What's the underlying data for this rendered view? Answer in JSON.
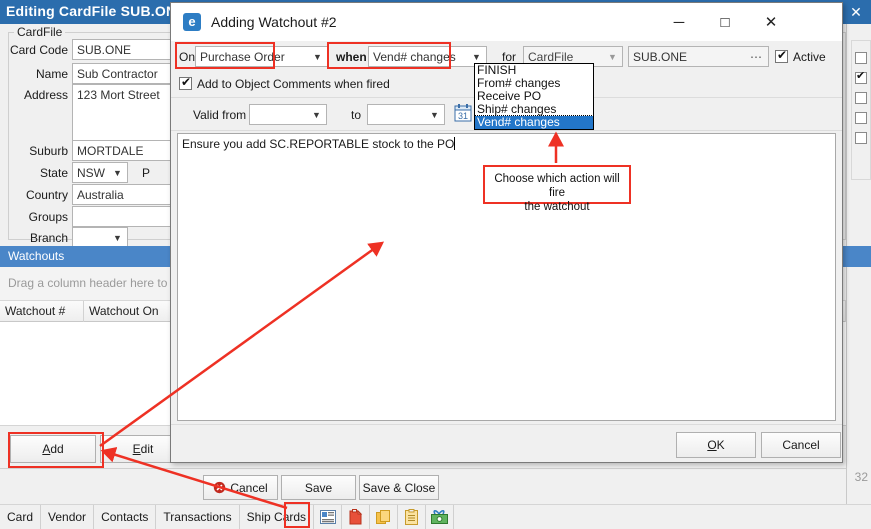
{
  "background_window": {
    "title": "Editing CardFile SUB.ONE",
    "close_label": "✕",
    "group_legend": "CardFile",
    "fields": [
      {
        "label": "Card Code",
        "value": "SUB.ONE"
      },
      {
        "label": "Name",
        "value": "Sub Contractor"
      },
      {
        "label": "Address",
        "value": "123 Mort Street"
      },
      {
        "label": "Suburb",
        "value": "MORTDALE"
      },
      {
        "label": "State",
        "value": "NSW"
      },
      {
        "label": "Country",
        "value": "Australia"
      },
      {
        "label": "Groups",
        "value": ""
      },
      {
        "label": "Branch",
        "value": ""
      }
    ],
    "post_label": "P",
    "watchouts": {
      "section_title": "Watchouts",
      "group_hint": "Drag a column header here to gro",
      "columns": [
        "Watchout #",
        "Watchout On"
      ],
      "rows": []
    },
    "grid_buttons": {
      "add": "Add",
      "edit": "Edit"
    },
    "bottom_buttons": {
      "cancel": "Cancel",
      "save": "Save",
      "save_close": "Save & Close"
    },
    "tabs": [
      "Card",
      "Vendor",
      "Contacts",
      "Transactions",
      "Ship Cards"
    ],
    "tab_icons": [
      "card-details-icon",
      "watchout-clipboard-icon",
      "copy-pages-icon",
      "notes-clipboard-icon",
      "money-gift-icon"
    ],
    "status_number": "32"
  },
  "dialog": {
    "title": "Adding Watchout #2",
    "icon": "watchout-app-icon",
    "minimize_label": "─",
    "maximize_label": "□",
    "close_label": "✕",
    "on_label": "On",
    "on_value": "Purchase Order",
    "when_label": "when",
    "when_value": "Vend# changes",
    "for_label": "for",
    "for_value": "CardFile",
    "for_code": "SUB.ONE",
    "ellipsis_label": "⋯",
    "active_label": "Active",
    "add_comments_label": "Add to Object Comments when fired",
    "valid_from_label": "Valid from",
    "valid_from_value": "",
    "to_label": "to",
    "to_value": "",
    "calendar_icon": "calendar-31-icon",
    "calendar_day": "31",
    "memo_text": "Ensure you add SC.REPORTABLE stock to the PO",
    "ok_label": "OK",
    "cancel_label": "Cancel",
    "dropdown": {
      "options": [
        "FINISH",
        "From# changes",
        "Receive PO",
        "Ship# changes",
        "Vend# changes"
      ],
      "selected": "Vend# changes"
    }
  },
  "annotation": {
    "callout_line1": "Choose which action will fire",
    "callout_line2": "the watchout",
    "color": "#ee3124"
  },
  "colors": {
    "title_blue": "#2b6dad",
    "accent_blue": "#4a86c8",
    "highlight_red": "#ee3124",
    "select_blue": "#2376c9"
  }
}
